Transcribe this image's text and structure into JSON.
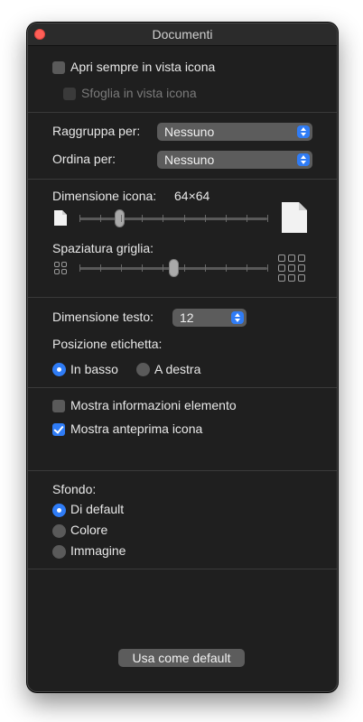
{
  "window": {
    "title": "Documenti"
  },
  "view_options": {
    "always_open_icon_view": {
      "label": "Apri sempre in vista icona",
      "checked": false
    },
    "browse_icon_view": {
      "label": "Sfoglia in vista icona",
      "checked": false,
      "enabled": false
    }
  },
  "grouping": {
    "group_by_label": "Raggruppa per:",
    "group_by_value": "Nessuno",
    "sort_by_label": "Ordina per:",
    "sort_by_value": "Nessuno"
  },
  "icon_size": {
    "label": "Dimensione icona:",
    "value": "64×64",
    "slider_fraction": 0.21
  },
  "grid_spacing": {
    "label": "Spaziatura griglia:",
    "slider_fraction": 0.5
  },
  "text": {
    "size_label": "Dimensione testo:",
    "size_value": "12",
    "label_position_label": "Posizione etichetta:",
    "options": [
      "In basso",
      "A destra"
    ],
    "selected": "In basso"
  },
  "info": {
    "show_item_info": {
      "label": "Mostra informazioni elemento",
      "checked": false
    },
    "show_icon_preview": {
      "label": "Mostra anteprima icona",
      "checked": true
    }
  },
  "background": {
    "label": "Sfondo:",
    "options": [
      "Di default",
      "Colore",
      "Immagine"
    ],
    "selected": "Di default"
  },
  "footer": {
    "use_as_default_label": "Usa come default"
  },
  "colors": {
    "accent": "#2f7cf6",
    "window_bg": "#1f1f1f",
    "close_button": "#ff5f57"
  },
  "icons": {
    "small_document": "small-document-icon",
    "large_document": "large-document-icon",
    "small_grid": "small-grid-icon",
    "large_grid": "large-grid-icon"
  }
}
